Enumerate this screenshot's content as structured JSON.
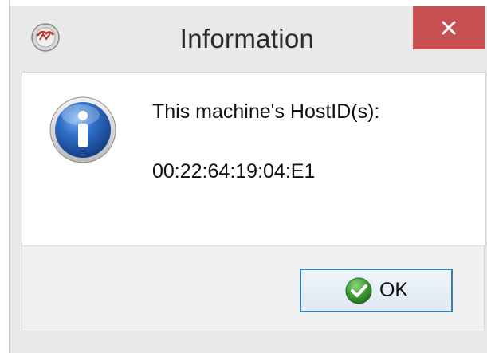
{
  "window": {
    "title": "Information",
    "close_symbol": "✕",
    "icons": {
      "app": "app-logo-icon",
      "close": "close-icon",
      "info": "info-icon",
      "ok": "check-circle-icon"
    },
    "colors": {
      "close_bg": "#c75050",
      "info_blue": "#1f5fb8",
      "ok_green": "#3f9c35",
      "ok_border": "#3c7fb1"
    }
  },
  "message": {
    "line1": "This machine's HostID(s):",
    "line2": "00:22:64:19:04:E1"
  },
  "buttons": {
    "ok_label": "OK"
  }
}
